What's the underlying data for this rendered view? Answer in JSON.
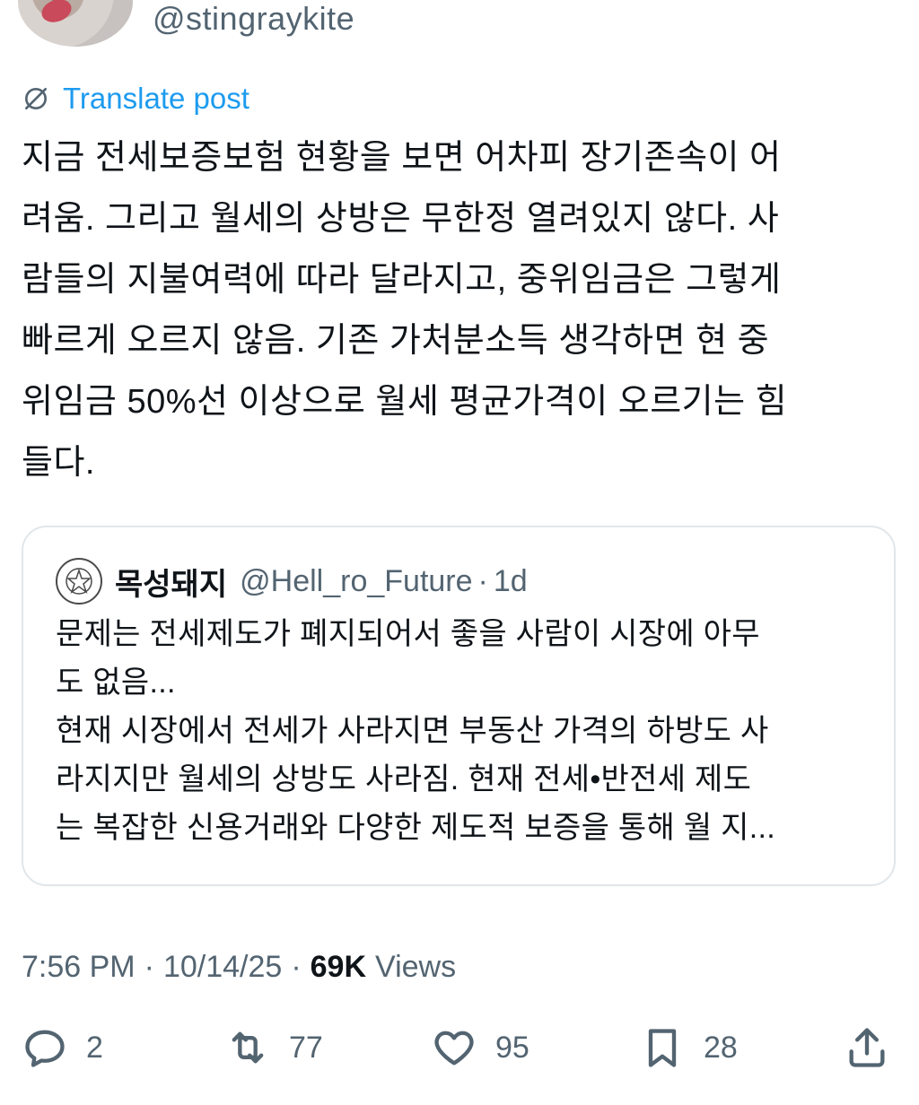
{
  "author": {
    "handle": "@stingraykite"
  },
  "translate": {
    "label": "Translate post",
    "icon": "globe-slash-icon",
    "color": "#1d9bf0"
  },
  "tweet": {
    "text": "지금 전세보증보험 현황을 보면 어차피 장기존속이 어\n려움. 그리고 월세의 상방은 무한정 열려있지 않다. 사\n람들의 지불여력에 따라 달라지고, 중위임금은 그렇게\n빠르게 오르지 않음. 기존 가처분소득 생각하면 현 중\n위임금 50%선 이상으로 월세 평균가격이 오르기는 힘\n들다."
  },
  "quote": {
    "name": "목성돼지",
    "handle": "@Hell_ro_Future",
    "separator": "·",
    "time": "1d",
    "text": "문제는 전세제도가 폐지되어서 좋을 사람이 시장에 아무\n도 없음...\n현재 시장에서 전세가 사라지면 부동산 가격의 하방도 사\n라지지만 월세의 상방도 사라짐. 현재 전세•반전세 제도\n는 복잡한 신용거래와 다양한 제도적 보증을 통해 월 지..."
  },
  "meta": {
    "time": "7:56 PM",
    "sep1": "·",
    "date": "10/14/25",
    "sep2": "·",
    "views_count": "69K",
    "views_label": "Views"
  },
  "actions": {
    "replies": "2",
    "reposts": "77",
    "likes": "95",
    "bookmarks": "28"
  },
  "colors": {
    "text": "#0f1419",
    "secondary": "#536471",
    "border": "#e1e6ea",
    "link": "#1d9bf0"
  }
}
